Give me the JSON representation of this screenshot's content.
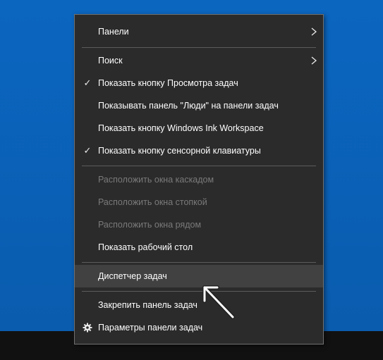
{
  "menu": {
    "items": [
      {
        "label": "Панели",
        "submenu": true
      },
      {
        "label": "Поиск",
        "submenu": true
      },
      {
        "label": "Показать кнопку Просмотра задач",
        "checked": true
      },
      {
        "label": "Показывать панель \"Люди\" на панели задач"
      },
      {
        "label": "Показать кнопку Windows Ink Workspace"
      },
      {
        "label": "Показать кнопку сенсорной клавиатуры",
        "checked": true
      },
      {
        "label": "Расположить окна каскадом",
        "disabled": true
      },
      {
        "label": "Расположить окна стопкой",
        "disabled": true
      },
      {
        "label": "Расположить окна рядом",
        "disabled": true
      },
      {
        "label": "Показать рабочий стол"
      },
      {
        "label": "Диспетчер задач",
        "highlighted": true
      },
      {
        "label": "Закрепить панель задач"
      },
      {
        "label": "Параметры панели задач",
        "icon": "gear-icon"
      }
    ]
  },
  "colors": {
    "desktop": "#0a62b8",
    "menu_bg": "#2b2b2b",
    "highlight": "#414141",
    "disabled_text": "#7a7a7a",
    "taskbar": "#111111"
  }
}
